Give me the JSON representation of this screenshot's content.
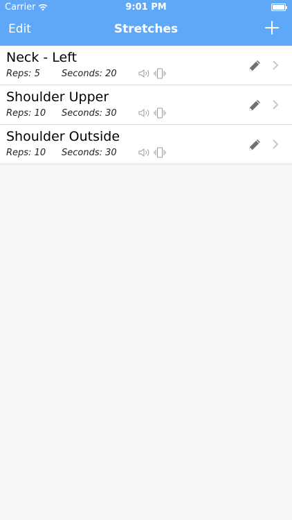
{
  "status_bar": {
    "carrier": "Carrier",
    "time": "9:01 PM"
  },
  "navbar": {
    "edit_label": "Edit",
    "title": "Stretches"
  },
  "stretches": [
    {
      "name": "Neck - Left",
      "reps": "Reps: 5",
      "seconds": "Seconds: 20"
    },
    {
      "name": "Shoulder Upper",
      "reps": "Reps: 10",
      "seconds": "Seconds: 30"
    },
    {
      "name": "Shoulder Outside",
      "reps": "Reps: 10",
      "seconds": "Seconds: 30"
    }
  ],
  "colors": {
    "nav_background": "#5fa8f8",
    "page_background": "#f7f7f7"
  },
  "icons": [
    "wifi-icon",
    "battery-icon",
    "add-icon",
    "sound-icon",
    "vibrate-icon",
    "pencil-icon",
    "chevron-right-icon"
  ]
}
